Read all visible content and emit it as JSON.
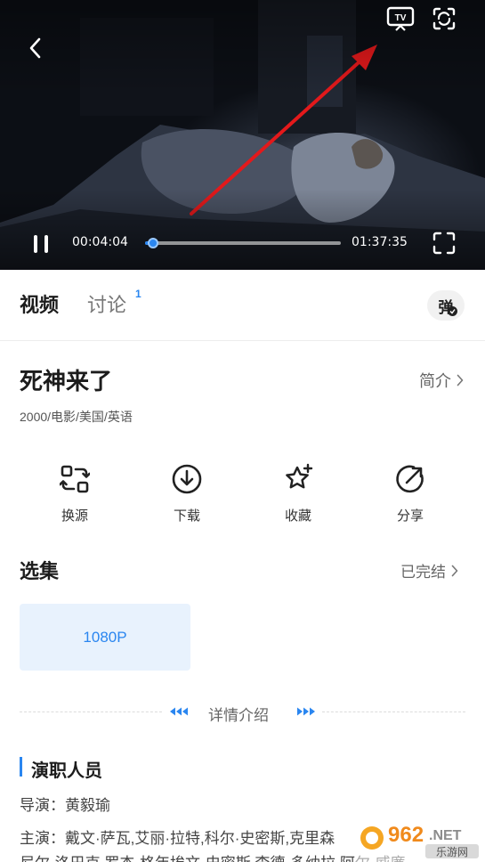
{
  "player": {
    "current_time": "00:04:04",
    "total_time": "01:37:35",
    "progress_fraction": 0.042,
    "accent_color": "#2a86f0",
    "icons": {
      "back": "chevron-left-icon",
      "cast_tv": "tv-cast-icon",
      "rotate": "screen-rotate-icon",
      "pause": "pause-icon",
      "fullscreen": "fullscreen-icon"
    }
  },
  "tabs": {
    "video_label": "视频",
    "discuss_label": "讨论",
    "discuss_count": "1",
    "danmu_label": "弹"
  },
  "movie": {
    "title": "死神来了",
    "intro_label": "简介",
    "meta": "2000/电影/美国/英语"
  },
  "actions": [
    {
      "label": "换源",
      "icon": "switch-source-icon"
    },
    {
      "label": "下载",
      "icon": "download-icon"
    },
    {
      "label": "收藏",
      "icon": "star-add-icon"
    },
    {
      "label": "分享",
      "icon": "share-icon"
    }
  ],
  "episodes": {
    "title": "选集",
    "status": "已完结",
    "items": [
      {
        "label": "1080P",
        "selected": true
      }
    ]
  },
  "details": {
    "label": "详情介绍"
  },
  "cast": {
    "title": "演职人员",
    "director": "导演：黄毅瑜",
    "actors": "主演：戴文·萨瓦,艾丽·拉特,科尔·史密斯,克里森",
    "actors_cont": "尼尔·洛巴克,罗杰·格年埃文·史密斯,李德·多纳拉,阿尔·威廉"
  },
  "watermark": {
    "brand": "962.NET",
    "sub": "乐游网"
  }
}
